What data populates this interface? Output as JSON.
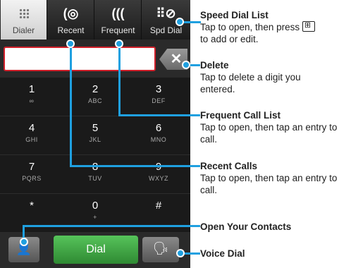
{
  "tabs": [
    {
      "label": "Dialer",
      "icon": "grid-icon"
    },
    {
      "label": "Recent",
      "icon": "recent-calls-icon"
    },
    {
      "label": "Frequent",
      "icon": "frequent-calls-icon"
    },
    {
      "label": "Spd Dial",
      "icon": "speed-dial-icon"
    }
  ],
  "delete_glyph": "✕",
  "keys": [
    {
      "digit": "1",
      "letters": "∞"
    },
    {
      "digit": "2",
      "letters": "ABC"
    },
    {
      "digit": "3",
      "letters": "DEF"
    },
    {
      "digit": "4",
      "letters": "GHI"
    },
    {
      "digit": "5",
      "letters": "JKL"
    },
    {
      "digit": "6",
      "letters": "MNO"
    },
    {
      "digit": "7",
      "letters": "PQRS"
    },
    {
      "digit": "8",
      "letters": "TUV"
    },
    {
      "digit": "9",
      "letters": "WXYZ"
    },
    {
      "digit": "*",
      "letters": ""
    },
    {
      "digit": "0",
      "letters": "+"
    },
    {
      "digit": "#",
      "letters": ""
    }
  ],
  "dial_label": "Dial",
  "annotations": {
    "speed_dial": {
      "title": "Speed Dial List",
      "text1": "Tap to open, then press",
      "text2": "to add or edit."
    },
    "delete": {
      "title": "Delete",
      "text": "Tap to delete a digit you entered."
    },
    "frequent": {
      "title": "Frequent Call List",
      "text": "Tap to open, then tap an entry to call."
    },
    "recent": {
      "title": "Recent Calls",
      "text": "Tap to open, then tap an entry to call."
    },
    "contacts": {
      "title": "Open Your Contacts"
    },
    "voice": {
      "title": "Voice Dial"
    }
  },
  "colors": {
    "accent": "#1fa0e0",
    "dial": "#3ea843",
    "field_border": "#d0202a"
  }
}
